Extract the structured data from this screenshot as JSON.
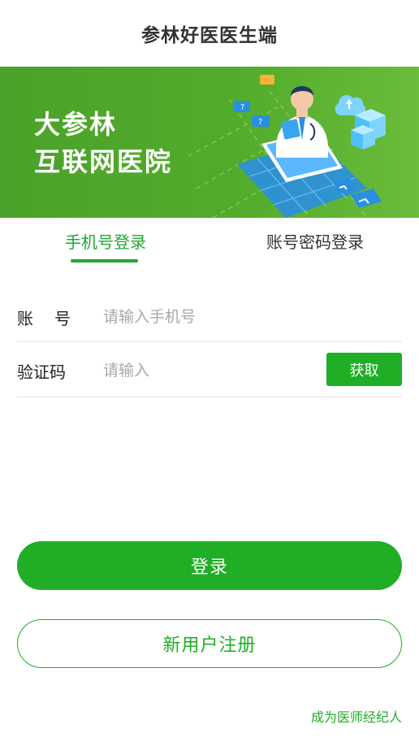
{
  "header": {
    "title": "参林好医医生端"
  },
  "banner": {
    "line1": "大参林",
    "line2": "互联网医院"
  },
  "tabs": [
    {
      "label": "手机号登录",
      "active": true
    },
    {
      "label": "账号密码登录",
      "active": false
    }
  ],
  "form": {
    "account_label": "账号",
    "account_placeholder": "请输入手机号",
    "code_label": "验证码",
    "code_placeholder": "请输入",
    "get_code_label": "获取"
  },
  "actions": {
    "login_label": "登录",
    "register_label": "新用户注册",
    "agent_link_label": "成为医师经纪人"
  },
  "colors": {
    "accent": "#1fae25",
    "banner_green": "#4aa32a",
    "text_dark": "#333333",
    "placeholder": "#a8a8a8"
  }
}
